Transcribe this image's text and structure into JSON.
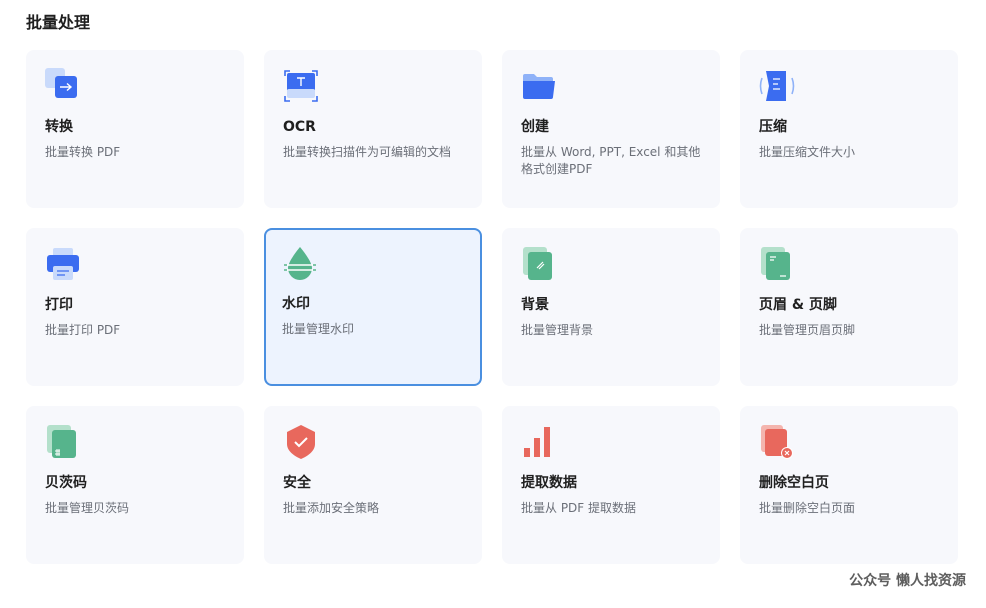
{
  "page_title": "批量处理",
  "cards": [
    {
      "title": "转换",
      "desc": "批量转换 PDF",
      "icon": "convert-icon"
    },
    {
      "title": "OCR",
      "desc": "批量转换扫描件为可编辑的文档",
      "icon": "ocr-scan-icon"
    },
    {
      "title": "创建",
      "desc": "批量从 Word, PPT, Excel 和其他格式创建PDF",
      "icon": "folder-icon"
    },
    {
      "title": "压缩",
      "desc": "批量压缩文件大小",
      "icon": "compress-icon"
    },
    {
      "title": "打印",
      "desc": "批量打印 PDF",
      "icon": "printer-icon"
    },
    {
      "title": "水印",
      "desc": "批量管理水印",
      "icon": "watermark-drop-icon"
    },
    {
      "title": "背景",
      "desc": "批量管理背景",
      "icon": "background-icon"
    },
    {
      "title": "页眉 & 页脚",
      "desc": "批量管理页眉页脚",
      "icon": "header-footer-icon"
    },
    {
      "title": "贝茨码",
      "desc": "批量管理贝茨码",
      "icon": "bates-number-icon"
    },
    {
      "title": "安全",
      "desc": "批量添加安全策略",
      "icon": "security-shield-icon"
    },
    {
      "title": "提取数据",
      "desc": "批量从 PDF 提取数据",
      "icon": "extract-data-icon"
    },
    {
      "title": "删除空白页",
      "desc": "批量删除空白页面",
      "icon": "delete-blank-page-icon"
    }
  ],
  "selected_card": "水印",
  "watermark_text": "公众号 懒人找资源",
  "colors": {
    "accent_blue": "#3b6cf0",
    "green": "#56b48c",
    "red": "#e8685d",
    "selected_border": "#4a8fe0"
  }
}
